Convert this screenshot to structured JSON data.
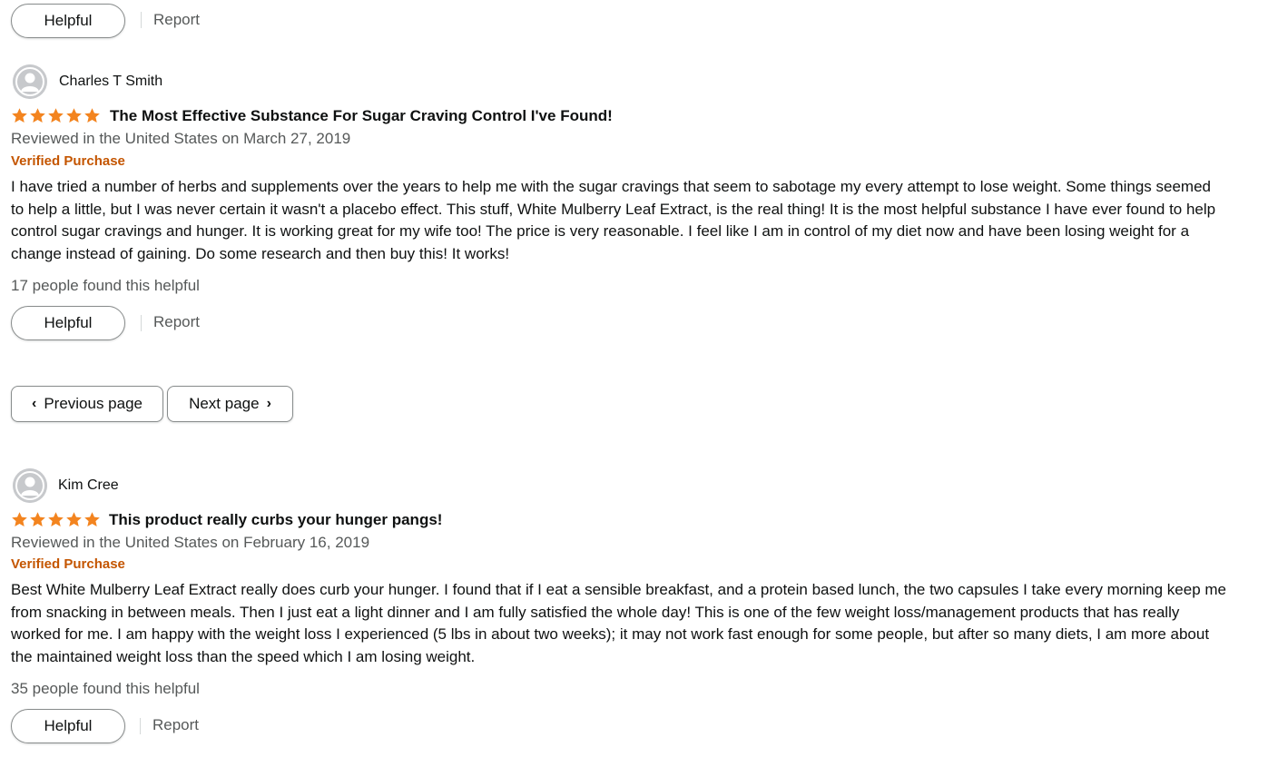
{
  "top_partial": {
    "helpful_label": "Helpful",
    "report_label": "Report"
  },
  "reviews": [
    {
      "reviewer": "Charles T Smith",
      "rating": 5,
      "title": "The Most Effective Substance For Sugar Craving Control I've Found!",
      "date": "Reviewed in the United States on March 27, 2019",
      "verified": "Verified Purchase",
      "body": "I have tried a number of herbs and supplements over the years to help me with the sugar cravings that seem to sabotage my every attempt to lose weight. Some things seemed to help a little, but I was never certain it wasn't a placebo effect. This stuff, White Mulberry Leaf Extract, is the real thing! It is the most helpful substance I have ever found to help control sugar cravings and hunger. It is working great for my wife too! The price is very reasonable. I feel like I am in control of my diet now and have been losing weight for a change instead of gaining. Do some research and then buy this! It works!",
      "helpful_count": "17 people found this helpful",
      "helpful_label": "Helpful",
      "report_label": "Report"
    },
    {
      "reviewer": "Kim Cree",
      "rating": 5,
      "title": "This product really curbs your hunger pangs!",
      "date": "Reviewed in the United States on February 16, 2019",
      "verified": "Verified Purchase",
      "body": "Best White Mulberry Leaf Extract really does curb your hunger. I found that if I eat a sensible breakfast, and a protein based lunch, the two capsules I take every morning keep me from snacking in between meals. Then I just eat a light dinner and I am fully satisfied the whole day! This is one of the few weight loss/management products that has really worked for me. I am happy with the weight loss I experienced (5 lbs in about two weeks); it may not work fast enough for some people, but after so many diets, I am more about the maintained weight loss than the speed which I am losing weight.",
      "helpful_count": "35 people found this helpful",
      "helpful_label": "Helpful",
      "report_label": "Report"
    }
  ],
  "pagination": {
    "previous_label": "Previous page",
    "next_label": "Next page"
  },
  "colors": {
    "star": "#f3841f",
    "verified": "#c45500",
    "muted_text": "#565959",
    "border": "#888c8c"
  },
  "icons": {
    "avatar": "user-avatar-icon",
    "star": "star-icon",
    "previous": "chevron-left-icon",
    "next": "chevron-right-icon"
  }
}
